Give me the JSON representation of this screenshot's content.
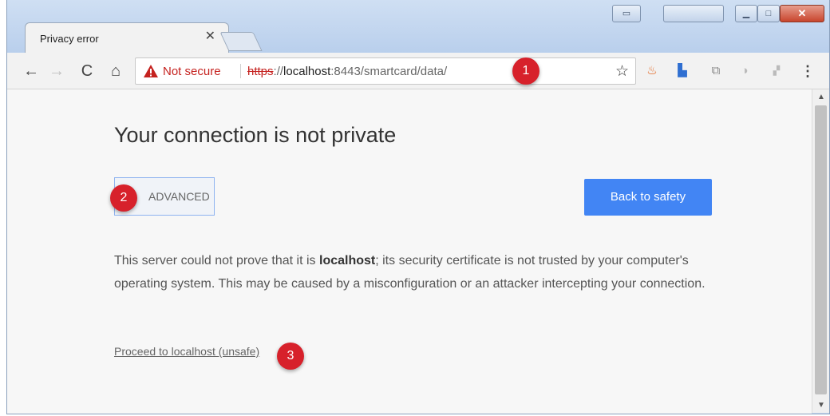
{
  "tab": {
    "title": "Privacy error",
    "close": "✕"
  },
  "toolbar": {
    "back": "←",
    "forward": "→",
    "reload": "C",
    "home": "⌂",
    "security_label": "Not secure",
    "url_scheme": "https",
    "url_sep": "://",
    "url_host": "localhost",
    "url_rest": ":8443/smartcard/data/",
    "bookmark": "☆",
    "menu": "⋮"
  },
  "annotations": [
    "1",
    "2",
    "3"
  ],
  "page": {
    "heading": "Your connection is not private",
    "advanced": "ADVANCED",
    "back_to_safety": "Back to safety",
    "body_pre": "This server could not prove that it is ",
    "body_host": "localhost",
    "body_post": "; its security certificate is not trusted by your computer's operating system. This may be caused by a misconfiguration or an attacker intercepting your connection.",
    "proceed_link": "Proceed to localhost (unsafe)"
  },
  "colors": {
    "accent_blue": "#4285f4",
    "warning_red": "#c5221f",
    "badge_red": "#d7212b"
  },
  "icons": [
    "warning-triangle-icon",
    "star-icon",
    "flame-extension-icon",
    "translate-extension-icon",
    "cast-extension-icon",
    "extension-icon",
    "menu-icon"
  ]
}
